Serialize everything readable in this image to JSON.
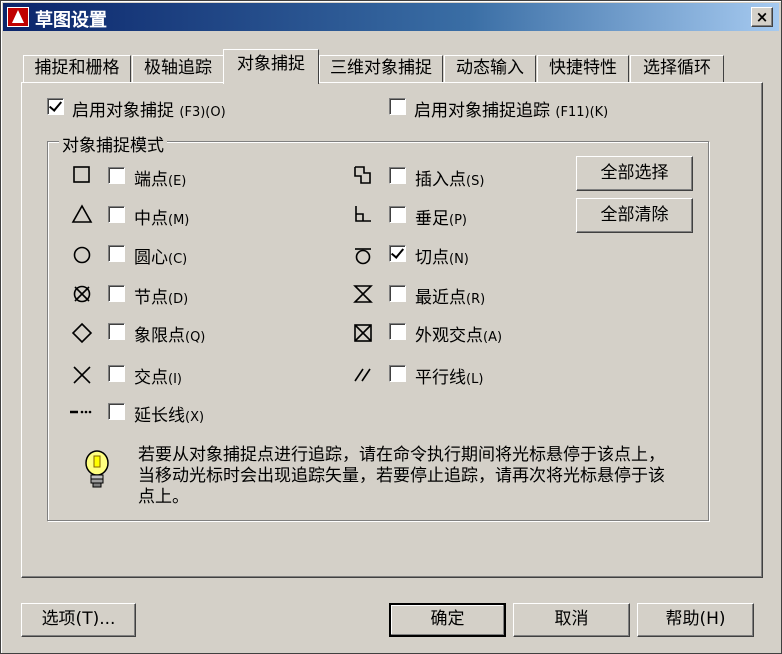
{
  "window": {
    "title": "草图设置",
    "close_glyph": "×"
  },
  "tabs": [
    {
      "label": "捕捉和栅格",
      "active": false
    },
    {
      "label": "极轴追踪",
      "active": false
    },
    {
      "label": "对象捕捉",
      "active": true
    },
    {
      "label": "三维对象捕捉",
      "active": false
    },
    {
      "label": "动态输入",
      "active": false
    },
    {
      "label": "快捷特性",
      "active": false
    },
    {
      "label": "选择循环",
      "active": false
    }
  ],
  "top_options": {
    "enable_osnap": {
      "label": "启用对象捕捉",
      "shortcut": "(F3)(O)",
      "checked": true
    },
    "enable_tracking": {
      "label": "启用对象捕捉追踪",
      "shortcut": "(F11)(K)",
      "checked": false
    }
  },
  "snap_modes": {
    "group_title": "对象捕捉模式",
    "left": [
      {
        "icon": "square-icon",
        "label": "端点",
        "shortcut": "(E)",
        "checked": false
      },
      {
        "icon": "triangle-icon",
        "label": "中点",
        "shortcut": "(M)",
        "checked": false
      },
      {
        "icon": "circle-icon",
        "label": "圆心",
        "shortcut": "(C)",
        "checked": false
      },
      {
        "icon": "node-icon",
        "label": "节点",
        "shortcut": "(D)",
        "checked": false
      },
      {
        "icon": "diamond-icon",
        "label": "象限点",
        "shortcut": "(Q)",
        "checked": false
      },
      {
        "icon": "cross-icon",
        "label": "交点",
        "shortcut": "(I)",
        "checked": false
      },
      {
        "icon": "extension-icon",
        "label": "延长线",
        "shortcut": "(X)",
        "checked": false
      }
    ],
    "right": [
      {
        "icon": "insertion-icon",
        "label": "插入点",
        "shortcut": "(S)",
        "checked": false
      },
      {
        "icon": "perpendicular-icon",
        "label": "垂足",
        "shortcut": "(P)",
        "checked": false
      },
      {
        "icon": "tangent-icon",
        "label": "切点",
        "shortcut": "(N)",
        "checked": true
      },
      {
        "icon": "nearest-icon",
        "label": "最近点",
        "shortcut": "(R)",
        "checked": false
      },
      {
        "icon": "apparent-intersection-icon",
        "label": "外观交点",
        "shortcut": "(A)",
        "checked": false
      },
      {
        "icon": "parallel-icon",
        "label": "平行线",
        "shortcut": "(L)",
        "checked": false
      }
    ],
    "select_all_label": "全部选择",
    "clear_all_label": "全部清除"
  },
  "tip": {
    "icon": "lightbulb-icon",
    "text": "若要从对象捕捉点进行追踪，请在命令执行期间将光标悬停于该点上，当移动光标时会出现追踪矢量，若要停止追踪，请再次将光标悬停于该点上。"
  },
  "footer": {
    "options_label": "选项(T)...",
    "ok_label": "确定",
    "cancel_label": "取消",
    "help_label": "帮助(H)"
  }
}
